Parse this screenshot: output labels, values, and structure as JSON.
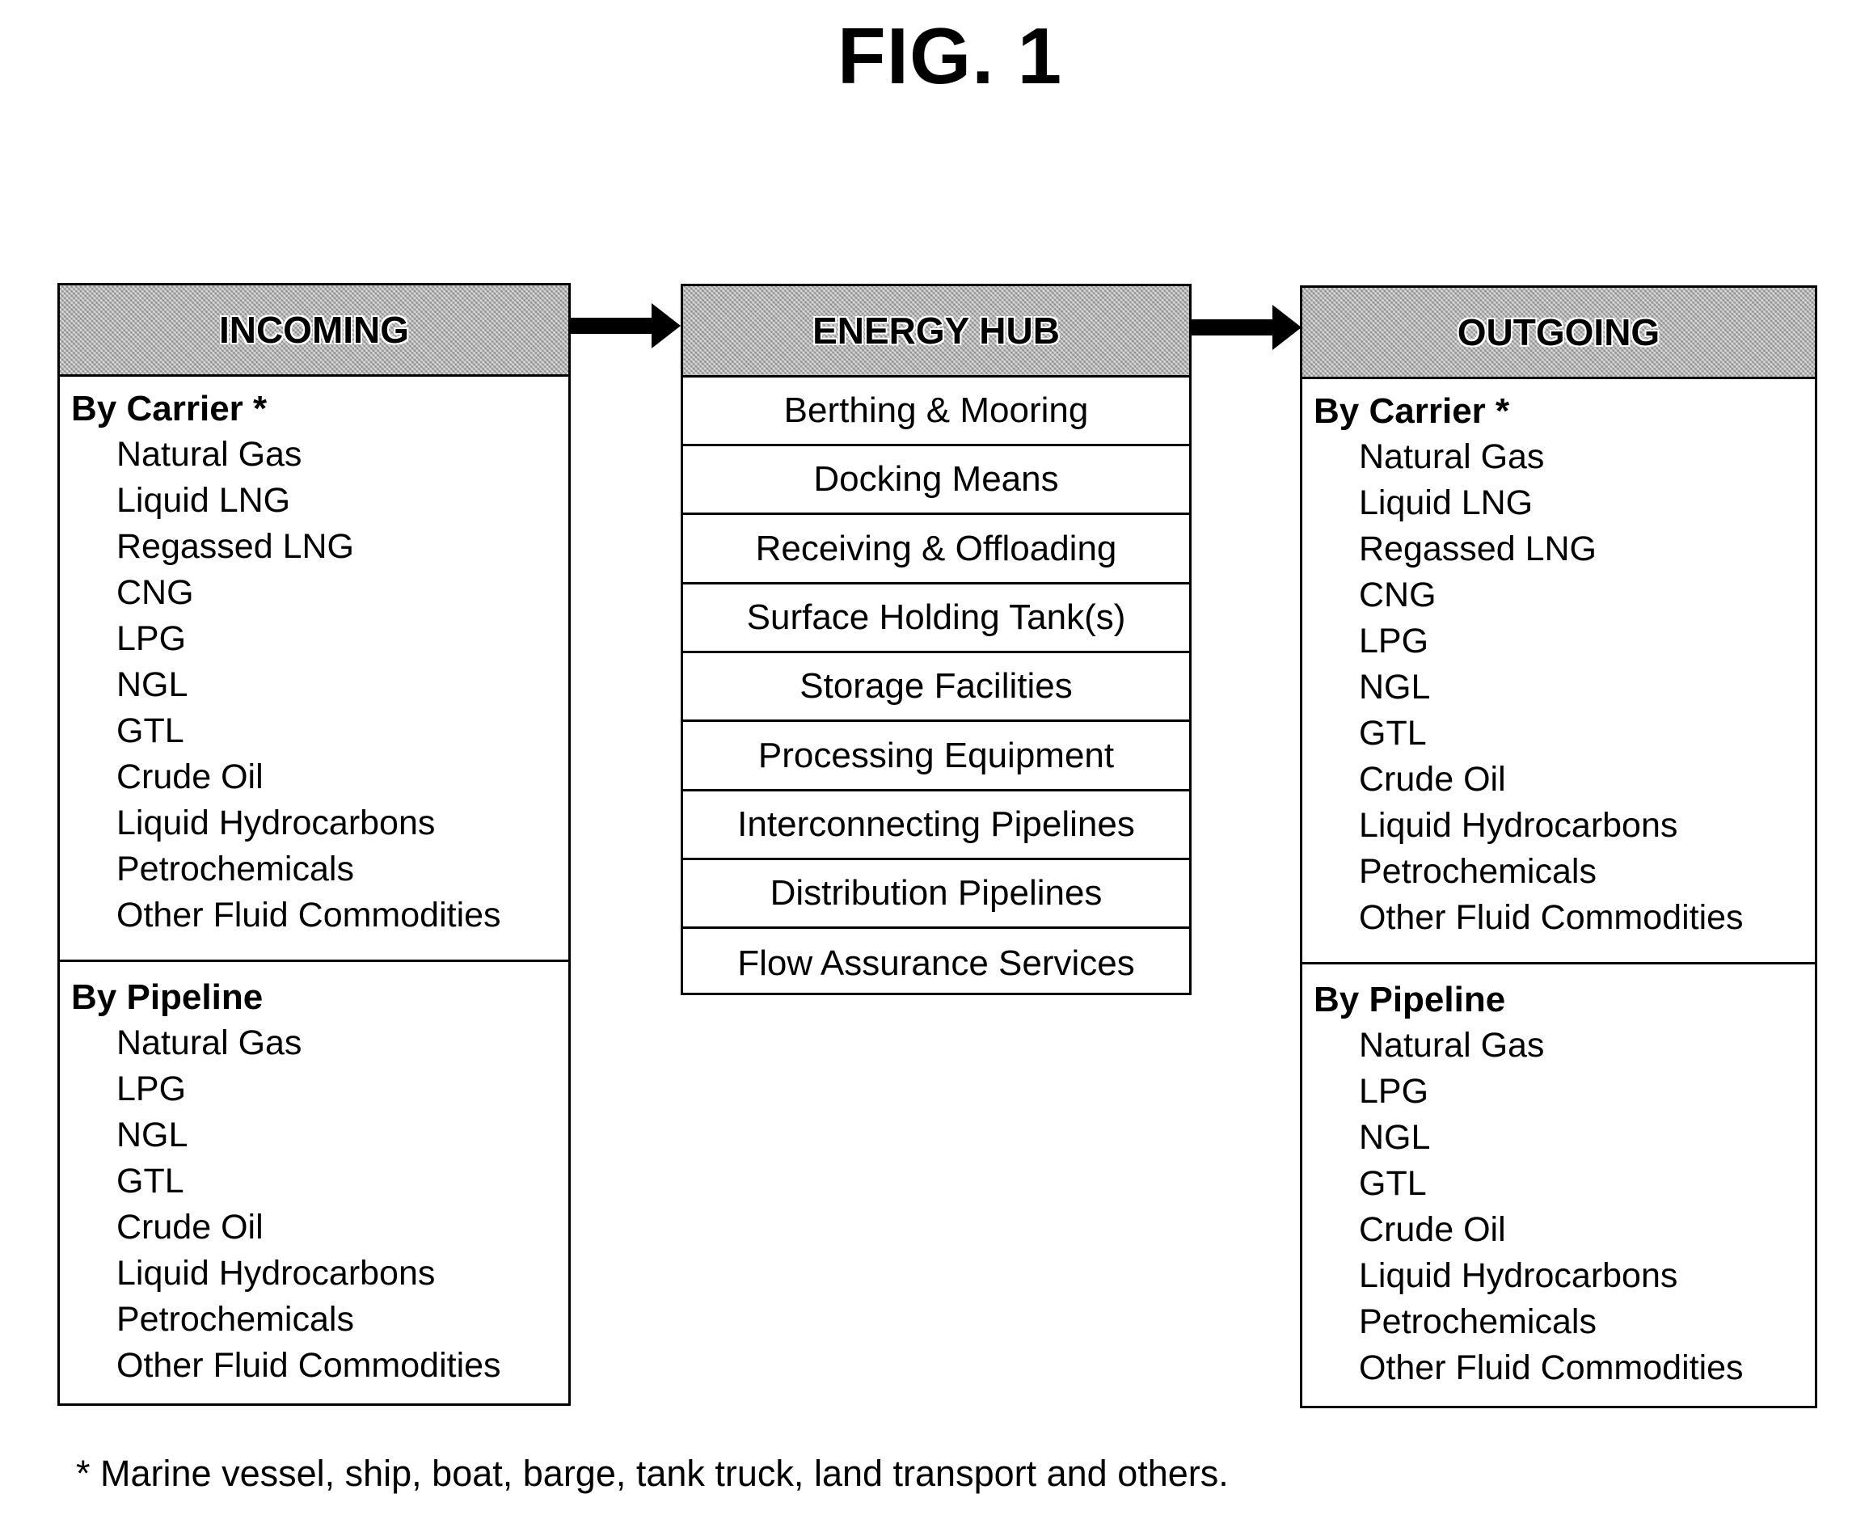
{
  "figure": {
    "title": "FIG. 1"
  },
  "incoming": {
    "header": "INCOMING",
    "by_carrier": {
      "title": "By Carrier *",
      "items": [
        "Natural Gas",
        "Liquid LNG",
        "Regassed LNG",
        "CNG",
        "LPG",
        "NGL",
        "GTL",
        "Crude Oil",
        "Liquid Hydrocarbons",
        "Petrochemicals",
        "Other Fluid Commodities"
      ]
    },
    "by_pipeline": {
      "title": "By Pipeline",
      "items": [
        "Natural Gas",
        "LPG",
        "NGL",
        "GTL",
        "Crude Oil",
        "Liquid Hydrocarbons",
        "Petrochemicals",
        "Other Fluid Commodities"
      ]
    }
  },
  "hub": {
    "header": "ENERGY HUB",
    "rows": [
      "Berthing & Mooring",
      "Docking Means",
      "Receiving & Offloading",
      "Surface Holding Tank(s)",
      "Storage Facilities",
      "Processing Equipment",
      "Interconnecting Pipelines",
      "Distribution Pipelines",
      "Flow Assurance Services"
    ]
  },
  "outgoing": {
    "header": "OUTGOING",
    "by_carrier": {
      "title": "By Carrier *",
      "items": [
        "Natural Gas",
        "Liquid LNG",
        "Regassed LNG",
        "CNG",
        "LPG",
        "NGL",
        "GTL",
        "Crude Oil",
        "Liquid Hydrocarbons",
        "Petrochemicals",
        "Other Fluid Commodities"
      ]
    },
    "by_pipeline": {
      "title": "By Pipeline",
      "items": [
        "Natural Gas",
        "LPG",
        "NGL",
        "GTL",
        "Crude Oil",
        "Liquid Hydrocarbons",
        "Petrochemicals",
        "Other Fluid Commodities"
      ]
    }
  },
  "arrows": [
    {
      "from": "INCOMING",
      "to": "ENERGY HUB",
      "icon": "arrow-right-icon"
    },
    {
      "from": "ENERGY HUB",
      "to": "OUTGOING",
      "icon": "arrow-right-icon"
    }
  ],
  "footnote": "* Marine vessel, ship, boat, barge, tank truck, land transport and others."
}
